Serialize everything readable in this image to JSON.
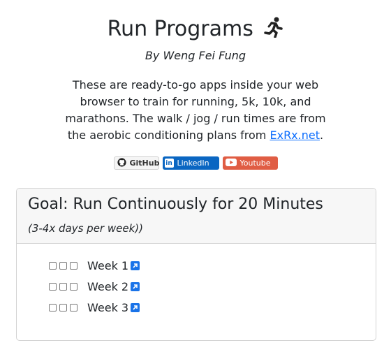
{
  "header": {
    "title": "Run Programs",
    "byline": "By Weng Fei Fung"
  },
  "intro": {
    "text": "These are ready-to-go apps inside your web browser to train for running, 5k, 10k, and marathons. The walk / jog / run times are from the aerobic conditioning plans from ",
    "link_text": "ExRx.net",
    "after_link": "."
  },
  "badges": {
    "github": "GitHub",
    "linkedin": "LinkedIn",
    "youtube": "Youtube"
  },
  "colors": {
    "linkedin": "#0a66c2",
    "youtube": "#e05d44",
    "link": "#0d6efd",
    "external_icon": "#1a73e8"
  },
  "program": {
    "goal": "Goal: Run Continuously for 20 Minutes",
    "frequency": "(3-4x days per week))",
    "weeks": [
      {
        "label": "Week 1"
      },
      {
        "label": "Week 2"
      },
      {
        "label": "Week 3"
      }
    ]
  }
}
